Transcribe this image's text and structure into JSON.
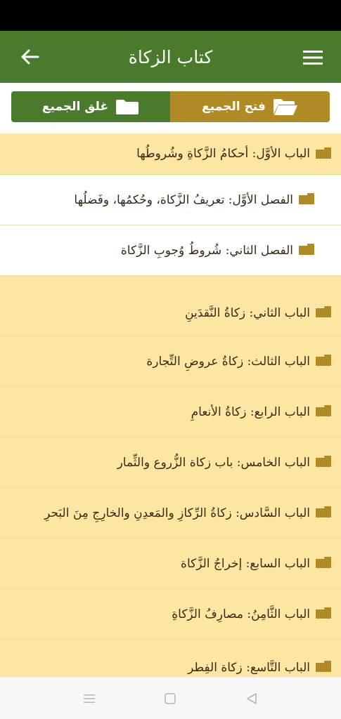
{
  "header": {
    "title": "كتاب الزكاة",
    "back_icon": "arrow-left-icon",
    "menu_icon": "hamburger-menu-icon"
  },
  "toggles": {
    "close_all": "غلق الجميع",
    "open_all": "فتح الجميع"
  },
  "items": [
    {
      "type": "chapter",
      "label": "الباب الأوَّل: أحكامُ الزَّكاةِ وشُروطُها"
    },
    {
      "type": "section",
      "label": "الفصل الأوَّل: تعريفُ الزَّكاة، وحُكمُها، وفَضلُها"
    },
    {
      "type": "section",
      "label": "الفصل الثاني: شُروطُ وُجوبِ الزَّكاة"
    },
    {
      "type": "chapter",
      "label": "الباب الثاني: زكاةُ النَّقدَينِ"
    },
    {
      "type": "chapter",
      "label": "الباب الثالث: زكاةُ عروضِ التِّجارة"
    },
    {
      "type": "chapter",
      "label": "الباب الرابع: زكاةُ الأنعامِ"
    },
    {
      "type": "chapter",
      "label": "الباب الخامس: باب زكاة الزُّروع والثِّمار"
    },
    {
      "type": "chapter",
      "label": "الباب السَّادس: زكاةُ الرِّكازِ والمَعدِنِ والخارِجِ مِنَ البَحرِ"
    },
    {
      "type": "chapter",
      "label": "الباب السابع: إخراجُ الزَّكاة"
    },
    {
      "type": "chapter",
      "label": "الباب الثَّامِنُ: مصارِفُ الزَّكاةِ"
    },
    {
      "type": "chapter",
      "label": "الباب التَّاسع: زكاة الفِطر"
    }
  ],
  "colors": {
    "primary_green": "#4a7a2c",
    "accent_gold": "#b08a24",
    "chapter_bg": "#fbe6a2"
  }
}
